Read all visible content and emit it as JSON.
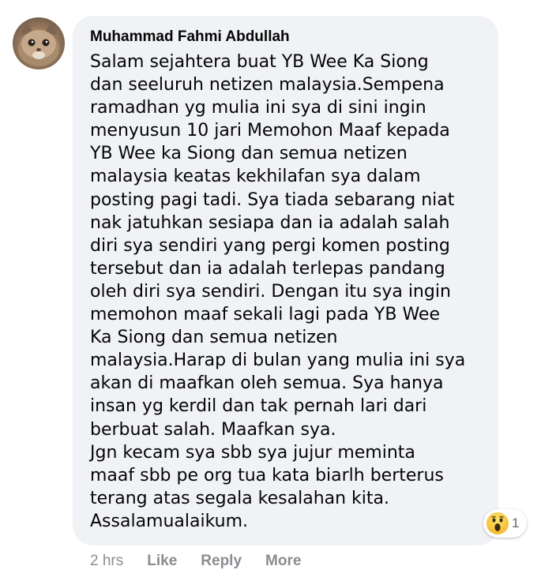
{
  "comment": {
    "author": "Muhammad Fahmi Abdullah",
    "avatar_icon": "cat-avatar",
    "lines": [
      "Salam sejahtera buat YB Wee Ka Siong",
      "dan seeluruh netizen malaysia.Sempena",
      "ramadhan yg mulia ini sya di sini ingin",
      "menyusun 10 jari Memohon Maaf kepada",
      "YB Wee ka Siong dan semua netizen",
      "malaysia keatas kekhilafan sya dalam",
      "posting pagi tadi. Sya tiada sebarang niat",
      "nak jatuhkan sesiapa dan ia adalah salah",
      "diri sya sendiri yang pergi komen posting",
      "tersebut dan ia adalah terlepas pandang",
      "oleh diri sya sendiri. Dengan itu sya ingin",
      "memohon maaf sekali lagi pada YB Wee",
      "Ka Siong dan semua netizen",
      "malaysia.Harap di bulan yang mulia ini sya",
      "akan di maafkan oleh semua. Sya hanya",
      "insan yg kerdil dan tak pernah lari dari",
      "berbuat salah. Maafkan sya.",
      "Jgn kecam sya sbb sya jujur meminta",
      "maaf sbb pe org tua kata biarlh berterus",
      "terang atas segala kesalahan kita.",
      "Assalamualaikum."
    ],
    "reaction": {
      "icon": "wow-reaction-icon",
      "count": "1"
    },
    "time": "2 hrs",
    "actions": {
      "like": "Like",
      "reply": "Reply",
      "more": "More"
    }
  }
}
